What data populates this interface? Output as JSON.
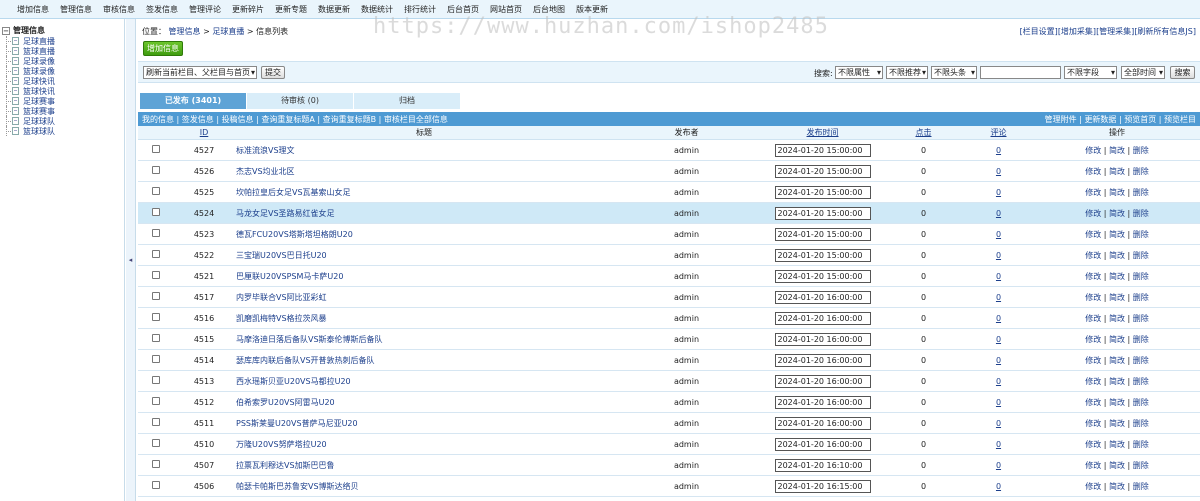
{
  "topnav": [
    "增加信息",
    "管理信息",
    "审核信息",
    "签发信息",
    "管理评论",
    "更新碎片",
    "更新专题",
    "数据更新",
    "数据统计",
    "排行统计",
    "后台首页",
    "网站首页",
    "后台地图",
    "版本更新"
  ],
  "sidebar": {
    "root": "管理信息",
    "items": [
      "足球直播",
      "篮球直播",
      "足球录像",
      "篮球录像",
      "足球快讯",
      "篮球快讯",
      "足球赛事",
      "篮球赛事",
      "足球球队",
      "篮球球队"
    ]
  },
  "collapse_glyph": "◂",
  "location": {
    "prefix": "位置：",
    "crumbs": [
      "管理信息",
      "足球直播",
      "信息列表"
    ],
    "sep": " > "
  },
  "toplinks": [
    "[栏目设置]",
    "[增加采集]",
    "[管理采集]",
    "[刷新所有信息JS]"
  ],
  "add_button": "增加信息",
  "filter": {
    "refresh_select": "刷新当前栏目、父栏目与首页",
    "submit": "提交",
    "search_label": "搜索:",
    "attr_select": "不限属性",
    "recommend_select": "不限推荐",
    "headline_select": "不限头条",
    "keyword_value": "",
    "field_select": "不限字段",
    "time_select": "全部时间",
    "search_button": "搜索"
  },
  "watermark": "https://www.huzhan.com/ishop2485",
  "tabs": [
    "已发布 (3401)",
    "待审核 (0)",
    "归档"
  ],
  "subbar": {
    "left": [
      "我的信息",
      "签发信息",
      "投稿信息",
      "查询重复标题A",
      "查询重复标题B",
      "审核栏目全部信息"
    ],
    "right": [
      "管理附件",
      "更新数据",
      "预览首页",
      "预览栏目"
    ]
  },
  "table": {
    "headers": {
      "id": "ID",
      "title": "标题",
      "publisher": "发布者",
      "time": "发布时间",
      "hits": "点击",
      "comments": "评论",
      "ops": "操作"
    },
    "op_labels": [
      "修改",
      "简改",
      "删除"
    ],
    "rows": [
      {
        "id": "4527",
        "title": "标准流浪VS理文",
        "publisher": "admin",
        "time": "2024-01-20 15:00:00",
        "hits": "0",
        "comments": "0"
      },
      {
        "id": "4526",
        "title": "杰志VS均业北区",
        "publisher": "admin",
        "time": "2024-01-20 15:00:00",
        "hits": "0",
        "comments": "0"
      },
      {
        "id": "4525",
        "title": "坎帕拉皇后女足VS瓦基索山女足",
        "publisher": "admin",
        "time": "2024-01-20 15:00:00",
        "hits": "0",
        "comments": "0"
      },
      {
        "id": "4524",
        "title": "马龙女足VS圣路易红雀女足",
        "publisher": "admin",
        "time": "2024-01-20 15:00:00",
        "hits": "0",
        "comments": "0",
        "highlight": true
      },
      {
        "id": "4523",
        "title": "德瓦FCU20VS塔斯塔坦格朗U20",
        "publisher": "admin",
        "time": "2024-01-20 15:00:00",
        "hits": "0",
        "comments": "0"
      },
      {
        "id": "4522",
        "title": "三宝瑞U20VS巴日托U20",
        "publisher": "admin",
        "time": "2024-01-20 15:00:00",
        "hits": "0",
        "comments": "0"
      },
      {
        "id": "4521",
        "title": "巴厘联U20VSPSM马卡萨U20",
        "publisher": "admin",
        "time": "2024-01-20 15:00:00",
        "hits": "0",
        "comments": "0"
      },
      {
        "id": "4517",
        "title": "内罗毕联合VS阿比亚彩虹",
        "publisher": "admin",
        "time": "2024-01-20 16:00:00",
        "hits": "0",
        "comments": "0"
      },
      {
        "id": "4516",
        "title": "凯磨凯梅特VS格拉茨风暴",
        "publisher": "admin",
        "time": "2024-01-20 16:00:00",
        "hits": "0",
        "comments": "0"
      },
      {
        "id": "4515",
        "title": "马摩洛迪日落后备队VS斯泰伦博斯后备队",
        "publisher": "admin",
        "time": "2024-01-20 16:00:00",
        "hits": "0",
        "comments": "0"
      },
      {
        "id": "4514",
        "title": "瑟库库内联后备队VS开普敦热刺后备队",
        "publisher": "admin",
        "time": "2024-01-20 16:00:00",
        "hits": "0",
        "comments": "0"
      },
      {
        "id": "4513",
        "title": "西水瑶斯贝亚U20VS马都拉U20",
        "publisher": "admin",
        "time": "2024-01-20 16:00:00",
        "hits": "0",
        "comments": "0"
      },
      {
        "id": "4512",
        "title": "伯希索罗U20VS阿雷马U20",
        "publisher": "admin",
        "time": "2024-01-20 16:00:00",
        "hits": "0",
        "comments": "0"
      },
      {
        "id": "4511",
        "title": "PSS斯莱曼U20VS普萨马尼亚U20",
        "publisher": "admin",
        "time": "2024-01-20 16:00:00",
        "hits": "0",
        "comments": "0"
      },
      {
        "id": "4510",
        "title": "万隆U20VS努萨塔拉U20",
        "publisher": "admin",
        "time": "2024-01-20 16:00:00",
        "hits": "0",
        "comments": "0"
      },
      {
        "id": "4507",
        "title": "拉票瓦利穆达VS加斯巴巴鲁",
        "publisher": "admin",
        "time": "2024-01-20 16:10:00",
        "hits": "0",
        "comments": "0"
      },
      {
        "id": "4506",
        "title": "帕瑟卡帕斯巴苏鲁安VS博斯达络贝",
        "publisher": "admin",
        "time": "2024-01-20 16:15:00",
        "hits": "0",
        "comments": "0"
      }
    ]
  }
}
